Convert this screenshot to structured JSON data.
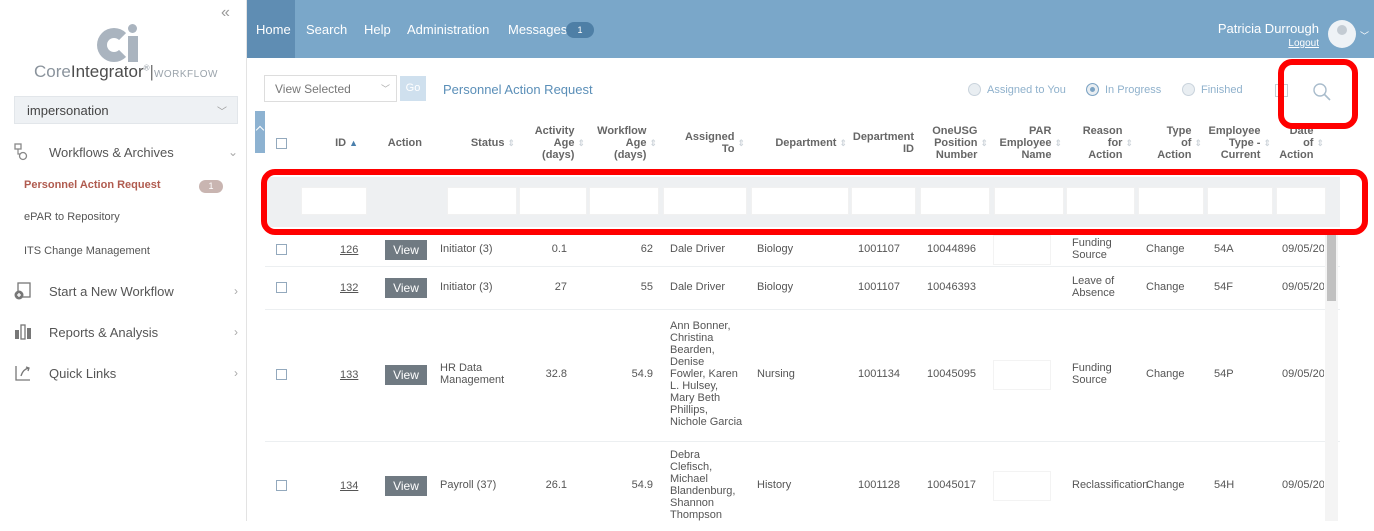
{
  "brand": {
    "name_light": "Core",
    "name_dark": "Integrator",
    "reg": "®",
    "sep": "|",
    "workflow": "WORKFLOW"
  },
  "impersonation": {
    "label": "impersonation"
  },
  "nav": {
    "workflows": "Workflows & Archives",
    "sub_items": [
      "Personnel Action Request",
      "ePAR to Repository",
      "ITS Change Management"
    ],
    "sub_badge": "1",
    "start": "Start a New Workflow",
    "reports": "Reports & Analysis",
    "links": "Quick Links"
  },
  "topbar": {
    "tabs": [
      "Home",
      "Search",
      "Help",
      "Administration",
      "Messages"
    ],
    "messages_count": "1",
    "user": "Patricia Durrough",
    "logout": "Logout"
  },
  "toolbar": {
    "view_selected": "View Selected",
    "go": "Go",
    "title": "Personnel Action Request",
    "filters": [
      "Assigned to You",
      "In Progress",
      "Finished"
    ],
    "active_filter": "In Progress"
  },
  "columns": [
    [
      "ID"
    ],
    [
      "Action"
    ],
    [
      "Status"
    ],
    [
      "Activity",
      "Age",
      "(days)"
    ],
    [
      "Workflow",
      "Age",
      "(days)"
    ],
    [
      "Assigned",
      "To"
    ],
    [
      "Department"
    ],
    [
      "Department",
      "ID"
    ],
    [
      "OneUSG",
      "Position",
      "Number"
    ],
    [
      "PAR",
      "Employee",
      "Name"
    ],
    [
      "Reason",
      "for",
      "Action"
    ],
    [
      "Type",
      "of",
      "Action"
    ],
    [
      "Employee",
      "Type -",
      "Current"
    ],
    [
      "Date",
      "of",
      "Action"
    ]
  ],
  "rows": [
    {
      "id": "126",
      "action": "View",
      "status": [
        "Initiator (3)"
      ],
      "activity_age": "0.1",
      "workflow_age": "62",
      "assigned_to": [
        "Dale Driver"
      ],
      "department": "Biology",
      "dept_id": "1001107",
      "position": "10044896",
      "reason": [
        "Funding",
        "Source"
      ],
      "type": "Change",
      "emp_type": "54A",
      "date": "09/05/20"
    },
    {
      "id": "132",
      "action": "View",
      "status": [
        "Initiator (3)"
      ],
      "activity_age": "27",
      "workflow_age": "55",
      "assigned_to": [
        "Dale Driver"
      ],
      "department": "Biology",
      "dept_id": "1001107",
      "position": "10046393",
      "reason": [
        "Leave of",
        "Absence"
      ],
      "type": "Change",
      "emp_type": "54F",
      "date": "09/05/20"
    },
    {
      "id": "133",
      "action": "View",
      "status": [
        "HR Data",
        "Management"
      ],
      "activity_age": "32.8",
      "workflow_age": "54.9",
      "assigned_to": [
        "Ann Bonner,",
        "Christina",
        "Bearden,",
        "Denise",
        "Fowler, Karen",
        "L. Hulsey,",
        "Mary Beth",
        "Phillips,",
        "Nichole Garcia"
      ],
      "department": "Nursing",
      "dept_id": "1001134",
      "position": "10045095",
      "reason": [
        "Funding",
        "Source"
      ],
      "type": "Change",
      "emp_type": "54P",
      "date": "09/05/20"
    },
    {
      "id": "134",
      "action": "View",
      "status": [
        "Payroll (37)"
      ],
      "activity_age": "26.1",
      "workflow_age": "54.9",
      "assigned_to": [
        "Debra",
        "Clefisch,",
        "Michael",
        "Blandenburg,",
        "Shannon",
        "Thompson"
      ],
      "department": "History",
      "dept_id": "1001128",
      "position": "10045017",
      "reason": [
        "Reclassification"
      ],
      "type": "Change",
      "emp_type": "54H",
      "date": "09/05/20"
    }
  ]
}
